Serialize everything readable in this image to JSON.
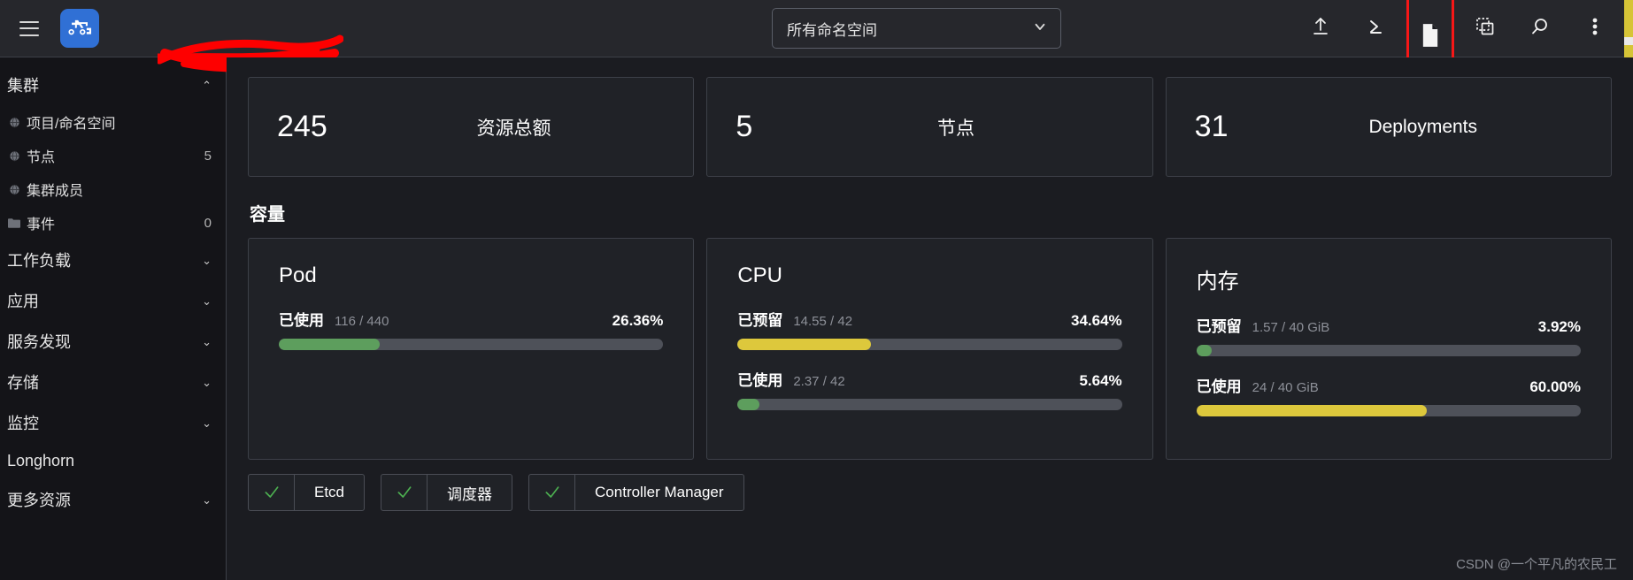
{
  "header": {
    "menu_icon": "hamburger-menu-icon",
    "logo_icon": "rancher-logo-icon",
    "brand_name_redacted": "",
    "namespace_select": {
      "value": "所有命名空间",
      "chevron_icon": "chevron-down-icon"
    },
    "toolbar": [
      {
        "icon": "upload-import-yaml-icon",
        "name": "import-yaml-button"
      },
      {
        "icon": "kubectl-shell-icon",
        "name": "kubectl-shell-button"
      },
      {
        "icon": "file-document-icon",
        "name": "download-kubeconfig-button",
        "highlighted": true
      },
      {
        "icon": "copy-clone-icon",
        "name": "copy-kubeconfig-button"
      },
      {
        "icon": "search-icon",
        "name": "search-button"
      },
      {
        "icon": "three-dots-vertical-icon",
        "name": "more-actions-button"
      }
    ]
  },
  "sidebar": {
    "groups": [
      {
        "label": "集群",
        "expanded": true,
        "chevron": "⌃",
        "items": [
          {
            "label": "项目/命名空间",
            "icon": "globe-icon",
            "count": ""
          },
          {
            "label": "节点",
            "icon": "globe-icon",
            "count": "5"
          },
          {
            "label": "集群成员",
            "icon": "globe-icon",
            "count": ""
          },
          {
            "label": "事件",
            "icon": "folder-icon",
            "count": "0"
          }
        ]
      },
      {
        "label": "工作负载",
        "expanded": false,
        "chevron": "⌄",
        "items": []
      },
      {
        "label": "应用",
        "expanded": false,
        "chevron": "⌄",
        "items": []
      },
      {
        "label": "服务发现",
        "expanded": false,
        "chevron": "⌄",
        "items": []
      },
      {
        "label": "存储",
        "expanded": false,
        "chevron": "⌄",
        "items": []
      },
      {
        "label": "监控",
        "expanded": false,
        "chevron": "⌄",
        "items": []
      },
      {
        "label": "Longhorn",
        "expanded": false,
        "chevron": "",
        "items": []
      },
      {
        "label": "更多资源",
        "expanded": false,
        "chevron": "⌄",
        "items": []
      }
    ]
  },
  "main": {
    "stats": [
      {
        "value": "245",
        "label": "资源总额"
      },
      {
        "value": "5",
        "label": "节点"
      },
      {
        "value": "31",
        "label": "Deployments"
      }
    ],
    "capacity_section_title": "容量",
    "capacity_cards": [
      {
        "title": "Pod",
        "gauges": [
          {
            "name": "已使用",
            "fraction": "116 / 440",
            "percent": "26.36%",
            "fill_pct": 26.36,
            "color": "#5d9e5d"
          }
        ]
      },
      {
        "title": "CPU",
        "gauges": [
          {
            "name": "已预留",
            "fraction": "14.55 / 42",
            "percent": "34.64%",
            "fill_pct": 34.64,
            "color": "#ddc83c"
          },
          {
            "name": "已使用",
            "fraction": "2.37 / 42",
            "percent": "5.64%",
            "fill_pct": 5.64,
            "color": "#5d9e5d"
          }
        ]
      },
      {
        "title": "内存",
        "gauges": [
          {
            "name": "已预留",
            "fraction": "1.57 / 40 GiB",
            "percent": "3.92%",
            "fill_pct": 3.92,
            "color": "#5d9e5d"
          },
          {
            "name": "已使用",
            "fraction": "24 / 40 GiB",
            "percent": "60.00%",
            "fill_pct": 60.0,
            "color": "#ddc83c"
          }
        ]
      }
    ],
    "components": [
      {
        "label": "Etcd",
        "status_icon": "check-icon"
      },
      {
        "label": "调度器",
        "status_icon": "check-icon"
      },
      {
        "label": "Controller Manager",
        "status_icon": "check-icon"
      }
    ]
  },
  "watermark": "CSDN @一个平凡的农民工",
  "colors": {
    "accent_blue": "#3070d5",
    "green": "#5d9e5d",
    "yellow": "#ddc83c",
    "highlight_red": "#f61717",
    "bg": "#1b1c21",
    "panel": "#202227",
    "sidebar_bg": "#141418"
  }
}
